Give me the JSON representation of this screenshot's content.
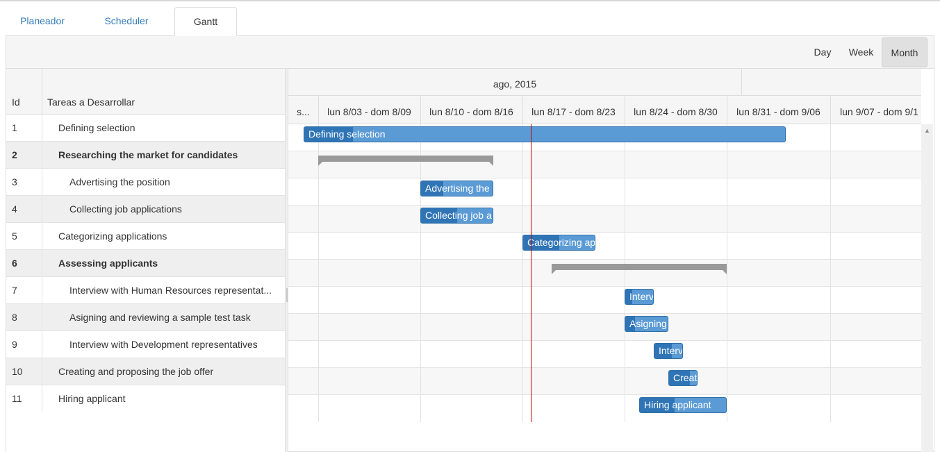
{
  "tabs": [
    {
      "label": "Planeador"
    },
    {
      "label": "Scheduler"
    },
    {
      "label": "Gantt"
    }
  ],
  "active_tab": "Gantt",
  "views": [
    {
      "label": "Day"
    },
    {
      "label": "Week"
    },
    {
      "label": "Month"
    }
  ],
  "active_view": "Month",
  "grid": {
    "col_id": "Id",
    "col_task": "Tareas a Desarrollar",
    "rows": [
      {
        "id": "1",
        "title": "Defining selection"
      },
      {
        "id": "2",
        "title": "Researching the market for candidates"
      },
      {
        "id": "3",
        "title": "Advertising the position"
      },
      {
        "id": "4",
        "title": "Collecting job applications"
      },
      {
        "id": "5",
        "title": "Categorizing applications"
      },
      {
        "id": "6",
        "title": "Assessing applicants"
      },
      {
        "id": "7",
        "title": "Interview with Human Resources representat..."
      },
      {
        "id": "8",
        "title": "Asigning and reviewing a sample test task"
      },
      {
        "id": "9",
        "title": "Interview with Development representatives"
      },
      {
        "id": "10",
        "title": "Creating and proposing the job offer"
      },
      {
        "id": "11",
        "title": "Hiring applicant"
      }
    ]
  },
  "timeline": {
    "month": "ago, 2015",
    "weeks": [
      "s...",
      "lun 8/03 - dom 8/09",
      "lun 8/10 - dom 8/16",
      "lun 8/17 - dom 8/23",
      "lun 8/24 - dom 8/30",
      "lun 8/31 - dom 9/06",
      "lun 9/07 - dom 9/1"
    ],
    "bars": [
      {
        "label": "Defining selection"
      },
      {
        "label": "Advertising the"
      },
      {
        "label": "Collecting job a"
      },
      {
        "label": "Categorizing ap"
      },
      {
        "label": "Interv"
      },
      {
        "label": "Asigning"
      },
      {
        "label": "Interv"
      },
      {
        "label": "Creat"
      },
      {
        "label": "Hiring applicant"
      }
    ]
  },
  "colors": {
    "bar": "#5b9bd5",
    "bar_progress": "#2f74b5",
    "summary": "#999999",
    "today_line": "#c00000",
    "tab_link": "#337ab7"
  }
}
